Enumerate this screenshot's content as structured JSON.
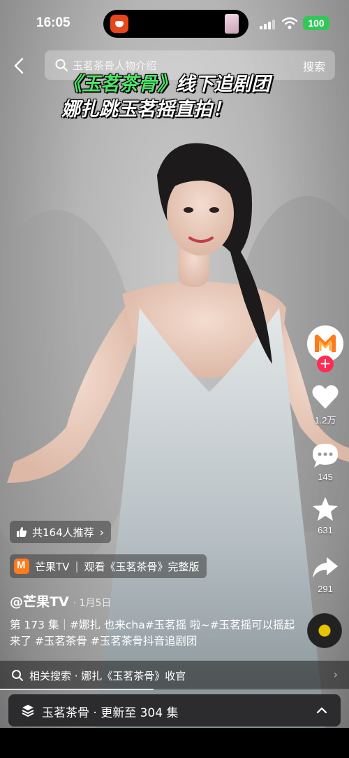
{
  "status_bar": {
    "time": "16:05",
    "battery": "100"
  },
  "search": {
    "placeholder": "玉茗茶骨人物介绍",
    "submit_label": "搜索"
  },
  "overlay_title": {
    "line1_green": "《玉茗茶骨》",
    "line1_white": "线下追剧团",
    "line2": "娜扎跳玉茗摇直拍！"
  },
  "side_actions": {
    "likes": "1.2万",
    "comments": "145",
    "favorites": "631",
    "shares": "291"
  },
  "recommend": {
    "label": "共164人推荐"
  },
  "source": {
    "channel": "芒果TV",
    "action": "观看《玉茗茶骨》完整版"
  },
  "author": {
    "handle": "@芒果TV",
    "date": "· 1月5日"
  },
  "description": "第 173 集｜#娜扎 也来cha#玉茗摇 啦~#玉茗摇可以摇起来了 #玉茗茶骨 #玉茗茶骨抖音追剧团",
  "related_search": {
    "text": "相关搜索 · 娜扎《玉茗茶骨》收官"
  },
  "playback": {
    "progress": 0.44
  },
  "series": {
    "text": "玉茗茶骨 · 更新至 304 集"
  },
  "colors": {
    "accent_green": "#4fe36a",
    "like_red": "#fe2c55",
    "brand_orange": "#ff7a1a",
    "battery_green": "#33c759"
  }
}
